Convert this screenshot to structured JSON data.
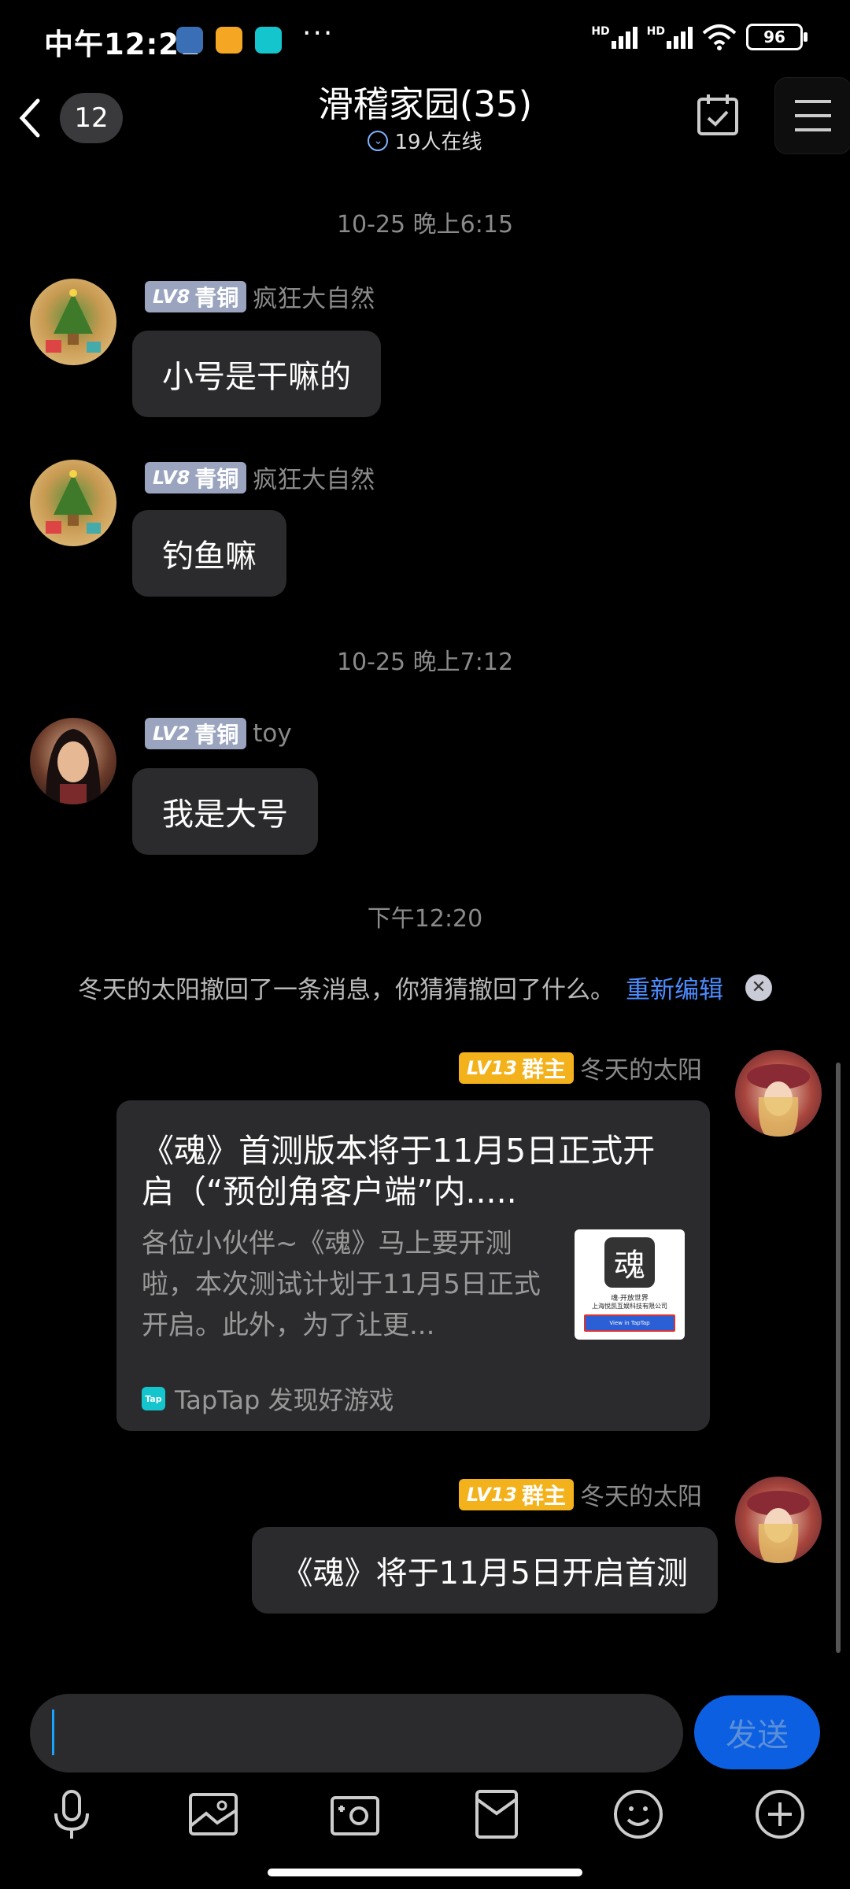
{
  "status_bar": {
    "time": "中午12:21",
    "more": "···",
    "network_1": "HD",
    "network_2": "HD",
    "battery": "96"
  },
  "header": {
    "unread_count": "12",
    "title": "滑稽家园(35)",
    "online": "19人在线"
  },
  "chat": {
    "timestamps": [
      "10-25 晚上6:15",
      "10-25 晚上7:12",
      "下午12:20"
    ],
    "messages": [
      {
        "level": "LV8",
        "rank": "青铜",
        "name": "疯狂大自然",
        "text": "小号是干嘛的"
      },
      {
        "level": "LV8",
        "rank": "青铜",
        "name": "疯狂大自然",
        "text": "钓鱼嘛"
      },
      {
        "level": "LV2",
        "rank": "青铜",
        "name": "toy",
        "text": "我是大号"
      },
      {
        "level": "LV13",
        "rank": "群主",
        "name": "冬天的太阳",
        "text": ""
      },
      {
        "level": "LV13",
        "rank": "群主",
        "name": "冬天的太阳",
        "text": "《魂》将于11月5日开启首测"
      }
    ],
    "recall": {
      "text": "冬天的太阳撤回了一条消息，你猜猜撤回了什么。",
      "link": "重新编辑"
    },
    "share_card": {
      "title": "《魂》首测版本将于11月5日正式开启（“预创角客户端”内.....",
      "description": "各位小伙伴~《魂》马上要开测啦，本次测试计划于11月5日正式开启。此外，为了让更...",
      "source": "TapTap 发现好游戏",
      "thumb_logo": "魂",
      "thumb_caption": "魂·开放世界",
      "thumb_company": "上海悦凯互娱科技有限公司",
      "thumb_button": "View in TapTap"
    }
  },
  "input": {
    "value": "",
    "send_label": "发送"
  },
  "colors": {
    "background": "#000000",
    "bubble": "#2b2b2d",
    "accent_blue": "#4d8cff",
    "owner_badge": "#f3b21b",
    "bronze_badge": "#9aa4bf"
  },
  "toolbar_icons": [
    "microphone-icon",
    "image-icon",
    "camera-icon",
    "red-packet-icon",
    "emoji-icon",
    "plus-icon"
  ]
}
